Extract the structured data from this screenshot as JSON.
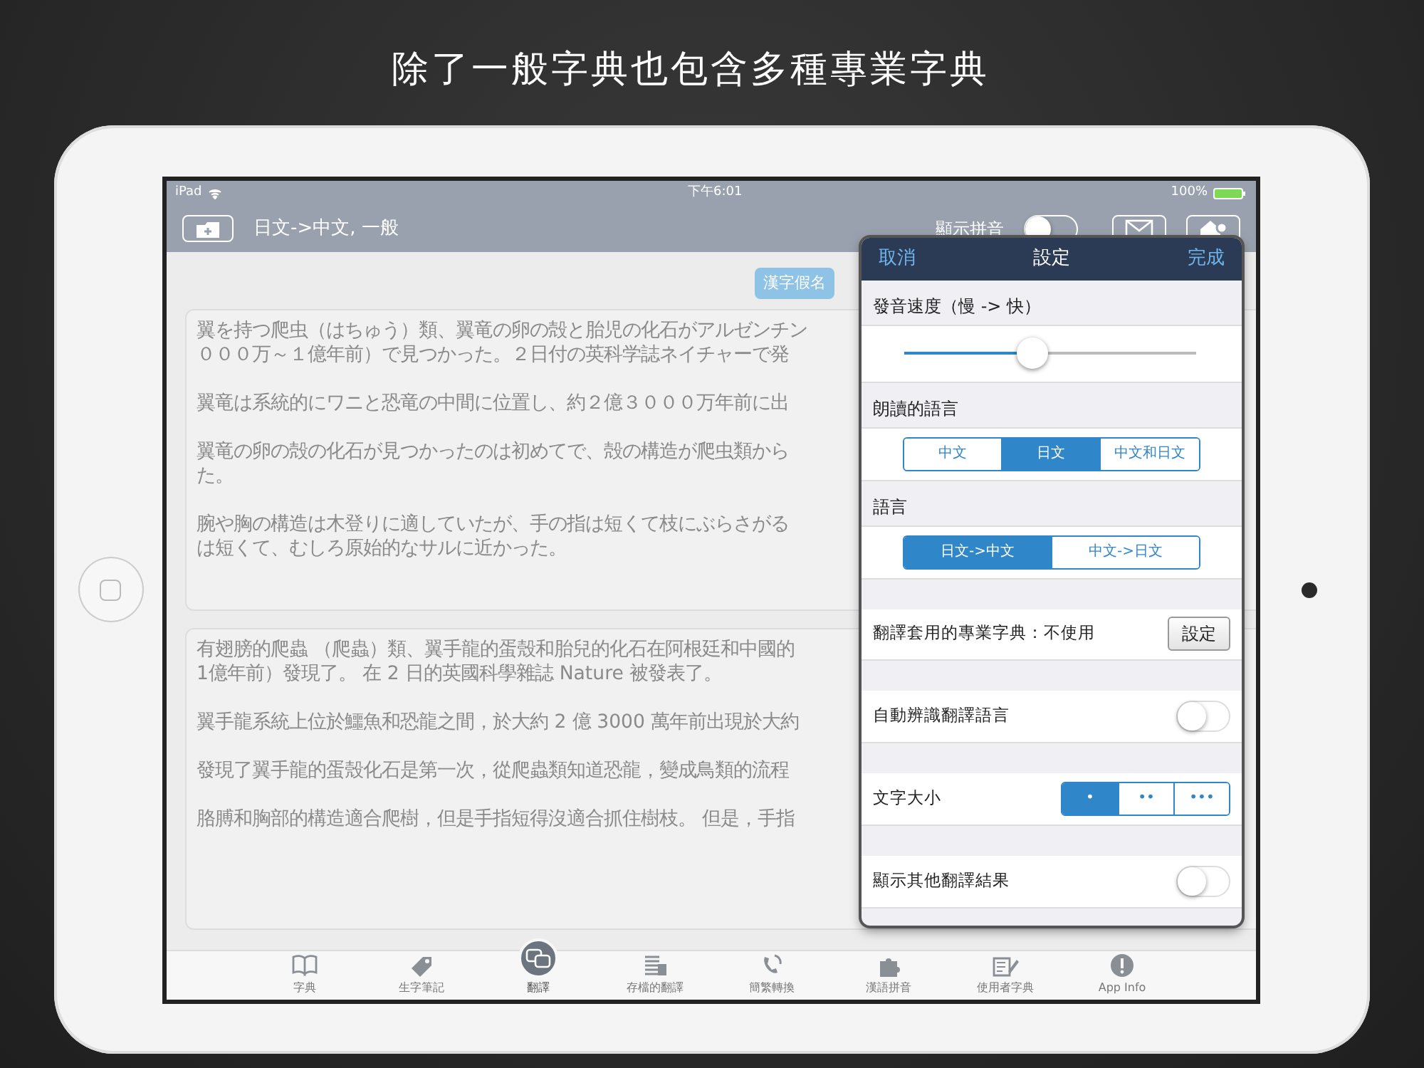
{
  "headline": "除了一般字典也包含多種專業字典",
  "status_bar": {
    "carrier": "iPad",
    "time": "下午6:01",
    "battery": "100%"
  },
  "nav_bar": {
    "title": "日文->中文, 一般",
    "pinyin_toggle": {
      "label": "顯示拼音",
      "on": false
    }
  },
  "kana_button": "漢字假名",
  "cards": [
    {
      "paragraphs": [
        [
          "翼を持つ爬虫（はちゅう）類、翼竜の卵の殻と胎児の化石がアルゼンチン",
          "０００万～１億年前）で見つかった。２日付の英科学誌ネイチャーで発"
        ],
        [
          "翼竜は系統的にワニと恐竜の中間に位置し、約２億３０００万年前に出"
        ],
        [
          "翼竜の卵の殻の化石が見つかったのは初めてで、殻の構造が爬虫類から",
          "た。"
        ],
        [
          "腕や胸の構造は木登りに適していたが、手の指は短くて枝にぶらさがる",
          "は短くて、むしろ原始的なサルに近かった。"
        ]
      ]
    },
    {
      "paragraphs": [
        [
          "有翅膀的爬蟲 （爬蟲）類、翼手龍的蛋殼和胎兒的化石在阿根廷和中國的",
          "1億年前）發現了。 在 2 日的英國科學雜誌 Nature 被發表了。"
        ],
        [
          "翼手龍系統上位於鱷魚和恐龍之間，於大約 2 億 3000 萬年前出現於大約"
        ],
        [
          "發現了翼手龍的蛋殼化石是第一次，從爬蟲類知道恐龍，變成鳥類的流程"
        ],
        [
          "胳膊和胸部的構造適合爬樹，但是手指短得沒適合抓住樹枝。 但是，手指"
        ]
      ]
    }
  ],
  "settings": {
    "cancel": "取消",
    "title": "設定",
    "done": "完成",
    "sections": [
      {
        "kind": "slider",
        "header": "發音速度（慢 -> 快）",
        "level": 0.44
      },
      {
        "kind": "segments",
        "header": "朗讀的語言",
        "options": [
          {
            "label": "中文",
            "selected": false
          },
          {
            "label": "日文",
            "selected": true
          },
          {
            "label": "中文和日文",
            "selected": false
          }
        ]
      },
      {
        "kind": "segments",
        "header": "語言",
        "options": [
          {
            "label": "日文->中文",
            "selected": true
          },
          {
            "label": "中文->日文",
            "selected": false
          }
        ]
      },
      {
        "kind": "button_row",
        "label": "翻譯套用的專業字典：不使用",
        "button": "設定"
      },
      {
        "kind": "toggle",
        "label": "自動辨識翻譯語言",
        "on": false
      },
      {
        "kind": "inline_segments",
        "label": "文字大小",
        "options": [
          {
            "label": "•",
            "selected": true
          },
          {
            "label": "••",
            "selected": false
          },
          {
            "label": "•••",
            "selected": false
          }
        ]
      },
      {
        "kind": "toggle",
        "label": "顯示其他翻譯結果",
        "on": false
      }
    ]
  },
  "tab_bar": [
    {
      "label": "字典",
      "selected": false
    },
    {
      "label": "生字筆記",
      "selected": false
    },
    {
      "label": "翻譯",
      "selected": true
    },
    {
      "label": "存檔的翻譯",
      "selected": false
    },
    {
      "label": "簡繁轉換",
      "selected": false
    },
    {
      "label": "漢語拼音",
      "selected": false
    },
    {
      "label": "使用者字典",
      "selected": false
    },
    {
      "label": "App Info",
      "selected": false
    }
  ]
}
